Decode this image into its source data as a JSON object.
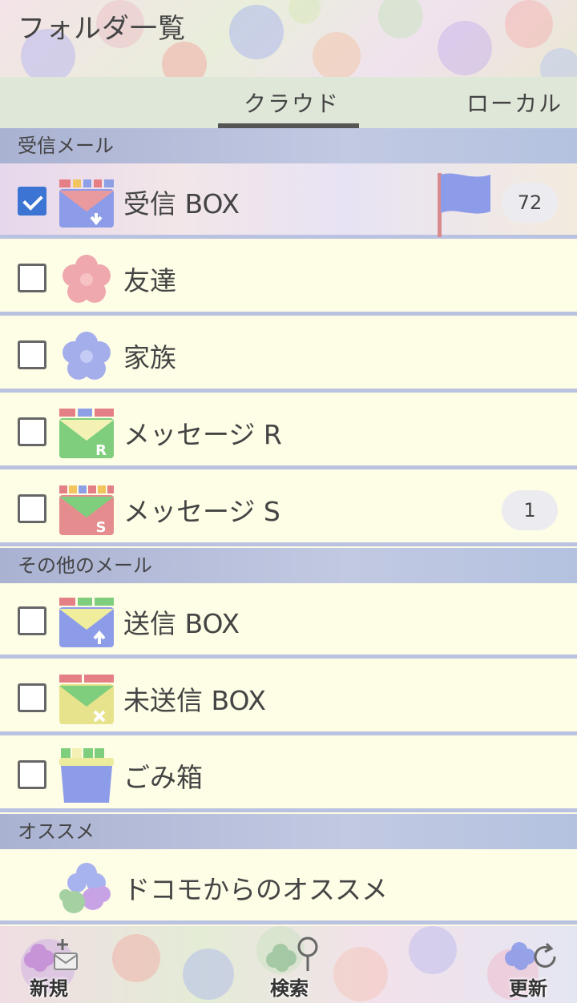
{
  "header": {
    "title": "フォルダ一覧"
  },
  "tabs": [
    {
      "label": "クラウド",
      "active": true
    },
    {
      "label": "ローカル",
      "active": false
    }
  ],
  "sections": {
    "inbox": "受信メール",
    "other": "その他のメール",
    "recommend": "オススメ"
  },
  "folders": [
    {
      "label": "受信 BOX",
      "checked": true,
      "badge": "72",
      "icon": "inbox-envelope-icon"
    },
    {
      "label": "友達",
      "checked": false,
      "badge": "",
      "icon": "pink-flower-icon"
    },
    {
      "label": "家族",
      "checked": false,
      "badge": "",
      "icon": "blue-flower-icon"
    },
    {
      "label": "メッセージ R",
      "checked": false,
      "badge": "",
      "icon": "message-r-envelope-icon"
    },
    {
      "label": "メッセージ S",
      "checked": false,
      "badge": "1",
      "icon": "message-s-envelope-icon"
    }
  ],
  "other_folders": [
    {
      "label": "送信 BOX",
      "checked": false,
      "icon": "outbox-envelope-icon"
    },
    {
      "label": "未送信 BOX",
      "checked": false,
      "icon": "unsent-envelope-icon"
    },
    {
      "label": "ごみ箱",
      "checked": false,
      "icon": "trash-icon"
    }
  ],
  "recommend": {
    "label": "ドコモからのオススメ",
    "icon": "hydrangea-icon"
  },
  "toolbar": {
    "new_label": "新規",
    "search_label": "検索",
    "refresh_label": "更新"
  },
  "colors": {
    "accent": "#3b74d3",
    "section_bg": "#aab2d2",
    "row_bg": "#fefde6",
    "divider": "#b9c2e0"
  }
}
